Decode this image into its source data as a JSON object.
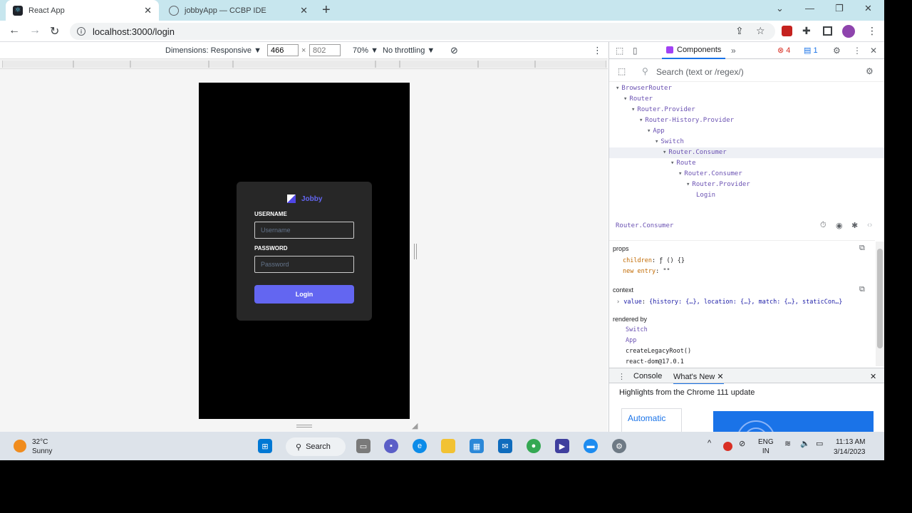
{
  "browser": {
    "tabs": [
      {
        "title": "React App",
        "close": "✕"
      },
      {
        "title": "jobbyApp — CCBP IDE",
        "close": "✕"
      }
    ],
    "new_tab": "+",
    "url": "localhost:3000/login"
  },
  "device_toolbar": {
    "dimensions_label": "Dimensions: Responsive ▼",
    "width": "466",
    "height": "802",
    "times": "×",
    "zoom": "70% ▼",
    "throttling": "No throttling ▼"
  },
  "login": {
    "logo_text": "Jobby",
    "username_label": "USERNAME",
    "username_placeholder": "Username",
    "password_label": "PASSWORD",
    "password_placeholder": "Password",
    "button_label": "Login"
  },
  "devtools": {
    "active_tab": "Components",
    "more_tabs": "»",
    "errors": "4",
    "messages": "1",
    "search_placeholder": "Search (text or /regex/)",
    "tree": [
      {
        "label": "BrowserRouter",
        "depth": 0,
        "arrow": "▾"
      },
      {
        "label": "Router",
        "depth": 1,
        "arrow": "▾"
      },
      {
        "label": "Router.Provider",
        "depth": 2,
        "arrow": "▾"
      },
      {
        "label": "Router-History.Provider",
        "depth": 3,
        "arrow": "▾"
      },
      {
        "label": "App",
        "depth": 4,
        "arrow": "▾"
      },
      {
        "label": "Switch",
        "depth": 5,
        "arrow": "▾"
      },
      {
        "label": "Router.Consumer",
        "depth": 6,
        "arrow": "▾",
        "selected": true
      },
      {
        "label": "Route",
        "depth": 7,
        "arrow": "▾"
      },
      {
        "label": "Router.Consumer",
        "depth": 8,
        "arrow": "▾"
      },
      {
        "label": "Router.Provider",
        "depth": 9,
        "arrow": "▾"
      },
      {
        "label": "Login",
        "depth": 10,
        "arrow": ""
      }
    ],
    "selected_component": "Router.Consumer",
    "props_heading": "props",
    "props": [
      {
        "key": "children",
        "value": "ƒ () {}"
      },
      {
        "key": "new entry",
        "value": "\"\""
      }
    ],
    "context_heading": "context",
    "context_value_key": "value",
    "context_value": "{history: {…}, location: {…}, match: {…}, staticCon…}",
    "rendered_by_heading": "rendered by",
    "rendered_by": [
      "Switch",
      "App",
      "createLegacyRoot()",
      "react-dom@17.0.1"
    ],
    "drawer_tabs": [
      "Console",
      "What's New"
    ],
    "whats_new_headline": "Highlights from the Chrome 111 update",
    "whats_new_card": "Automatic"
  },
  "taskbar": {
    "temperature": "32°C",
    "weather": "Sunny",
    "search": "Search",
    "lang_top": "ENG",
    "lang_bottom": "IN",
    "time": "11:13 AM",
    "date": "3/14/2023"
  },
  "colors": {
    "accent": "#6366f1",
    "card": "#272727",
    "tab_strip": "#c7e6ee"
  }
}
